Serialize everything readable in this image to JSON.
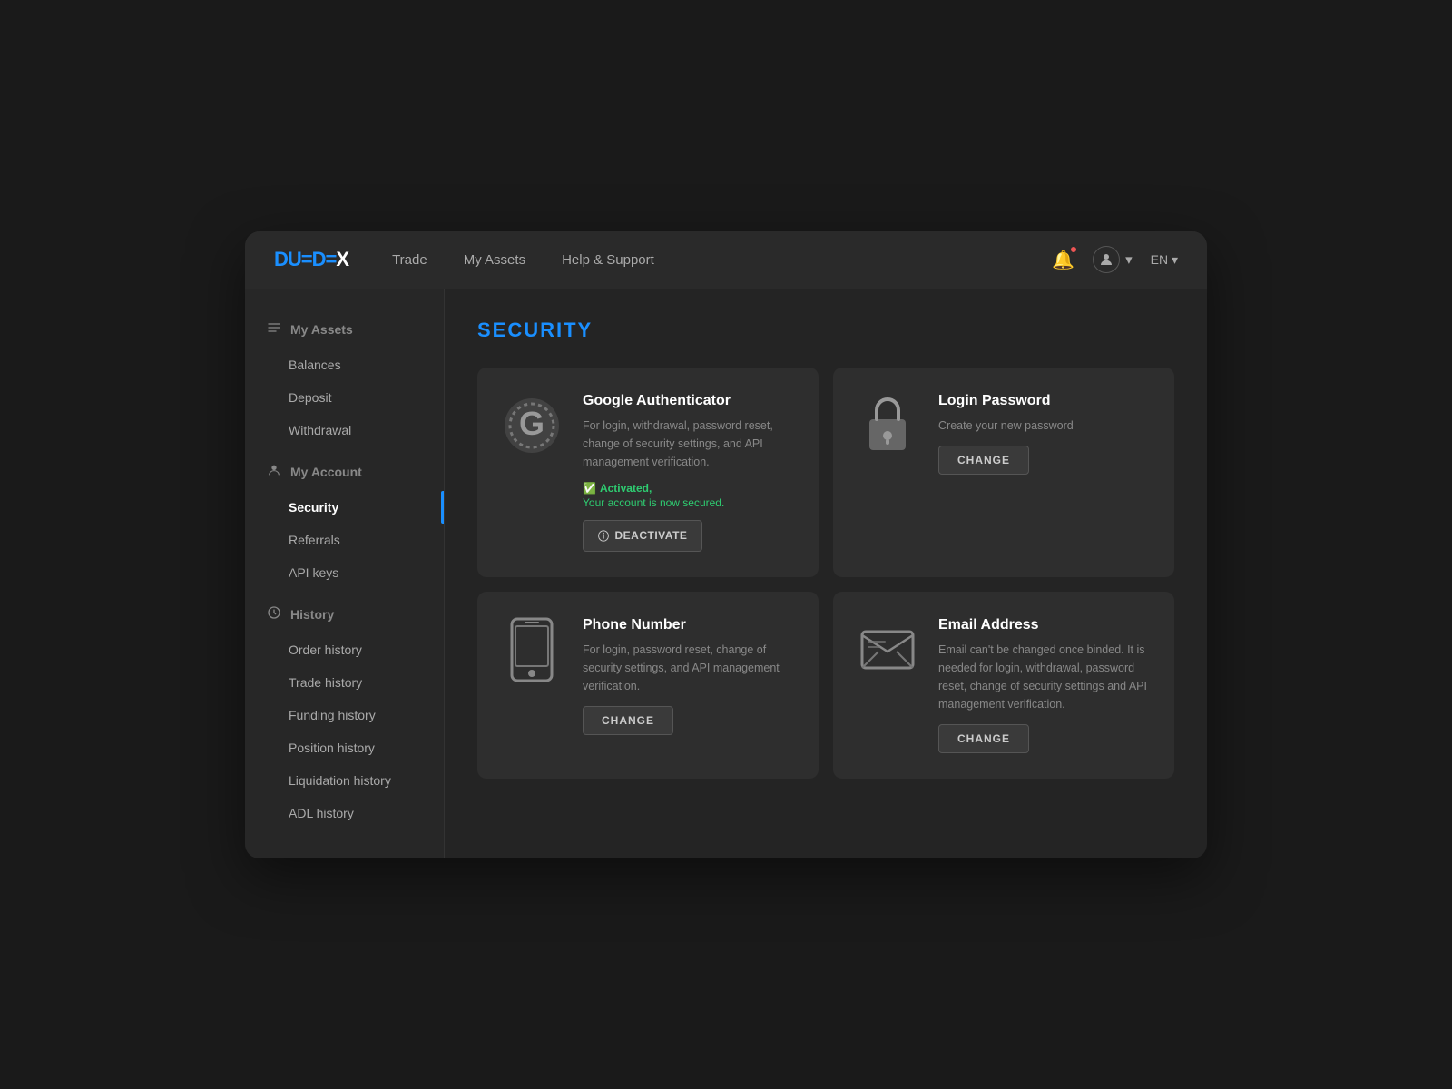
{
  "app": {
    "logo_due": "DUE",
    "logo_dex": "DEX",
    "logo_dash1": "=",
    "logo_dash2": "="
  },
  "header": {
    "nav": [
      {
        "label": "Trade",
        "id": "trade"
      },
      {
        "label": "My Assets",
        "id": "my-assets"
      },
      {
        "label": "Help & Support",
        "id": "help"
      }
    ],
    "lang": "EN ▾",
    "chevron": "▾"
  },
  "sidebar": {
    "sections": [
      {
        "id": "my-assets-section",
        "icon": "≡",
        "label": "My Assets",
        "items": [
          {
            "id": "balances",
            "label": "Balances",
            "active": false
          },
          {
            "id": "deposit",
            "label": "Deposit",
            "active": false
          },
          {
            "id": "withdrawal",
            "label": "Withdrawal",
            "active": false
          }
        ]
      },
      {
        "id": "my-account-section",
        "icon": "👤",
        "label": "My Account",
        "items": [
          {
            "id": "security",
            "label": "Security",
            "active": true
          },
          {
            "id": "referrals",
            "label": "Referrals",
            "active": false
          },
          {
            "id": "api-keys",
            "label": "API keys",
            "active": false
          }
        ]
      },
      {
        "id": "history-section",
        "icon": "⏱",
        "label": "History",
        "items": [
          {
            "id": "order-history",
            "label": "Order history",
            "active": false
          },
          {
            "id": "trade-history",
            "label": "Trade history",
            "active": false
          },
          {
            "id": "funding-history",
            "label": "Funding history",
            "active": false
          },
          {
            "id": "position-history",
            "label": "Position history",
            "active": false
          },
          {
            "id": "liquidation-history",
            "label": "Liquidation history",
            "active": false
          },
          {
            "id": "adl-history",
            "label": "ADL history",
            "active": false
          }
        ]
      }
    ]
  },
  "content": {
    "page_title": "SECURITY",
    "cards": [
      {
        "id": "google-authenticator",
        "title": "Google Authenticator",
        "description": "For login, withdrawal, password reset, change of security settings, and API management verification.",
        "activated": true,
        "activated_label": "Activated,",
        "secured_label": "Your account is now secured.",
        "button_label": "DEACTIVATE",
        "button_type": "deactivate"
      },
      {
        "id": "login-password",
        "title": "Login Password",
        "description": "Create your new password",
        "activated": false,
        "button_label": "CHANGE",
        "button_type": "change"
      },
      {
        "id": "phone-number",
        "title": "Phone Number",
        "description": "For login, password reset, change of security settings, and API management verification.",
        "activated": false,
        "button_label": "CHANGE",
        "button_type": "change"
      },
      {
        "id": "email-address",
        "title": "Email Address",
        "description": "Email can't be changed once binded. It is needed for login, withdrawal, password reset, change of security settings and API management verification.",
        "activated": false,
        "button_label": "CHANGE",
        "button_type": "change"
      }
    ]
  }
}
